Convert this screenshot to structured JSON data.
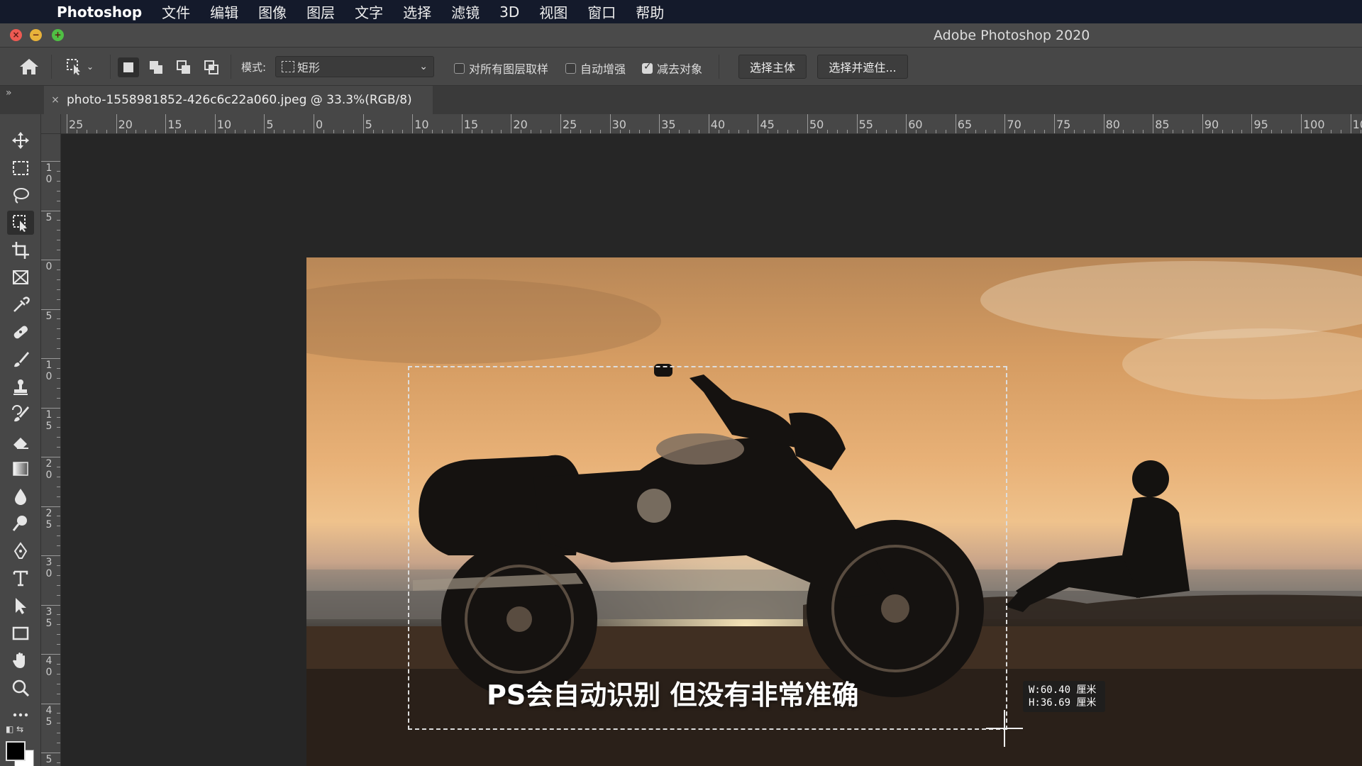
{
  "menubar": {
    "app_name": "Photoshop",
    "items": [
      "文件",
      "编辑",
      "图像",
      "图层",
      "文字",
      "选择",
      "滤镜",
      "3D",
      "视图",
      "窗口",
      "帮助"
    ]
  },
  "window": {
    "title": "Adobe Photoshop 2020"
  },
  "options": {
    "mode_label": "模式:",
    "mode_value": "矩形",
    "sample_all_layers": {
      "label": "对所有图层取样",
      "checked": false
    },
    "auto_enhance": {
      "label": "自动增强",
      "checked": false
    },
    "subtract_object": {
      "label": "减去对象",
      "checked": true
    },
    "select_subject_label": "选择主体",
    "select_and_mask_label": "选择并遮住..."
  },
  "document": {
    "tab_title": "photo-1558981852-426c6c22a060.jpeg @ 33.3%(RGB/8)"
  },
  "ruler": {
    "h_labels": [
      "25",
      "20",
      "15",
      "10",
      "5",
      "0",
      "5",
      "10",
      "15",
      "20",
      "25",
      "30",
      "35",
      "40",
      "45",
      "50",
      "55",
      "60",
      "65",
      "70",
      "75",
      "80",
      "85",
      "90",
      "95",
      "100",
      "10"
    ],
    "v_labels": [
      "10",
      "5",
      "0",
      "5",
      "10",
      "15",
      "20",
      "25",
      "30",
      "35",
      "40",
      "45",
      "5"
    ]
  },
  "overlay": {
    "subtitle": "PS会自动识别 但没有非常准确",
    "width_readout": "W:60.40 厘米",
    "height_readout": "H:36.69 厘米"
  },
  "tools": [
    "move-tool",
    "marquee-tool",
    "lasso-tool",
    "object-selection-tool",
    "crop-tool",
    "frame-tool",
    "eyedropper-tool",
    "healing-brush-tool",
    "brush-tool",
    "clone-stamp-tool",
    "history-brush-tool",
    "eraser-tool",
    "gradient-tool",
    "blur-tool",
    "dodge-tool",
    "pen-tool",
    "type-tool",
    "path-selection-tool",
    "rectangle-tool",
    "hand-tool",
    "zoom-tool",
    "more-tools"
  ],
  "colors": {
    "foreground": "#000000",
    "background": "#ffffff"
  }
}
